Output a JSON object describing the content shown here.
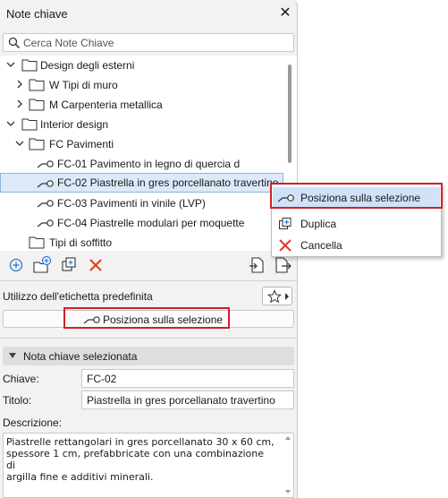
{
  "panel": {
    "title": "Note chiave",
    "search_placeholder": "Cerca Note Chiave"
  },
  "tree": [
    {
      "label": "Design degli esterni"
    },
    {
      "label": "W Tipi di muro"
    },
    {
      "label": "M Carpenteria metallica"
    },
    {
      "label": "Interior design"
    },
    {
      "label": "FC Pavimenti"
    },
    {
      "label": "FC-01 Pavimento in legno di quercia d"
    },
    {
      "label": "FC-02 Piastrella in gres porcellanato travertino"
    },
    {
      "label": "FC-03 Pavimenti in vinile (LVP)"
    },
    {
      "label": "FC-04 Piastrelle modulari per moquette"
    },
    {
      "label": "Tipi di soffitto"
    }
  ],
  "default_label": {
    "title": "Utilizzo dell'etichetta predefinita",
    "button_label": "Posiziona sulla selezione"
  },
  "selected": {
    "section_title": "Nota chiave selezionata",
    "key_label": "Chiave:",
    "key_value": "FC-02",
    "title_label": "Titolo:",
    "title_value": "Piastrella in gres porcellanato travertino",
    "desc_label": "Descrizione:",
    "desc_value": "Piastrelle rettangolari in gres porcellanato 30 x 60 cm,\nspessore 1 cm, prefabbricate con una combinazione di\nargilla fine e additivi minerali."
  },
  "context_menu": [
    {
      "label": "Posiziona sulla selezione",
      "icon": "place-keynote-icon"
    },
    {
      "label": "Duplica",
      "icon": "duplicate-icon"
    },
    {
      "label": "Cancella",
      "icon": "delete-x-icon"
    }
  ],
  "colors": {
    "highlight_red": "#d21f26",
    "selection_blue": "#dbe9f8",
    "accent_blue": "#2a7ad6"
  }
}
